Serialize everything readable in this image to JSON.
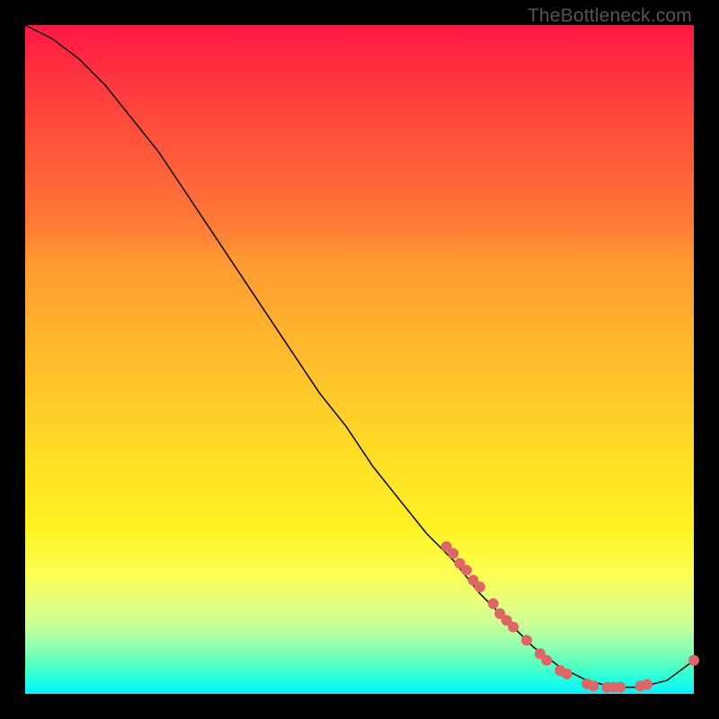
{
  "watermark": "TheBottleneck.com",
  "chart_data": {
    "type": "line",
    "title": "",
    "xlabel": "",
    "ylabel": "",
    "xlim": [
      0,
      100
    ],
    "ylim": [
      0,
      100
    ],
    "series": [
      {
        "name": "curve",
        "x": [
          0,
          4,
          8,
          12,
          16,
          20,
          24,
          28,
          32,
          36,
          40,
          44,
          48,
          52,
          56,
          60,
          64,
          68,
          72,
          76,
          80,
          84,
          88,
          92,
          96,
          100
        ],
        "y": [
          100,
          98,
          95,
          91,
          86,
          81,
          75,
          69,
          63,
          57,
          51,
          45,
          40,
          34,
          29,
          24,
          20,
          15,
          11,
          7,
          4,
          2,
          1,
          1,
          2,
          5
        ]
      }
    ],
    "scatter_points": {
      "name": "markers",
      "color": "#e06666",
      "points": [
        {
          "x": 63,
          "y": 22
        },
        {
          "x": 64,
          "y": 21
        },
        {
          "x": 65,
          "y": 19.5
        },
        {
          "x": 66,
          "y": 18.5
        },
        {
          "x": 67,
          "y": 17
        },
        {
          "x": 68,
          "y": 16
        },
        {
          "x": 70,
          "y": 13.5
        },
        {
          "x": 71,
          "y": 12
        },
        {
          "x": 72,
          "y": 11
        },
        {
          "x": 73,
          "y": 10
        },
        {
          "x": 75,
          "y": 8
        },
        {
          "x": 77,
          "y": 6
        },
        {
          "x": 78,
          "y": 5
        },
        {
          "x": 80,
          "y": 3.5
        },
        {
          "x": 81,
          "y": 3
        },
        {
          "x": 84,
          "y": 1.5
        },
        {
          "x": 85,
          "y": 1.2
        },
        {
          "x": 87,
          "y": 1
        },
        {
          "x": 88,
          "y": 1
        },
        {
          "x": 89,
          "y": 1
        },
        {
          "x": 92,
          "y": 1.2
        },
        {
          "x": 93,
          "y": 1.4
        },
        {
          "x": 100,
          "y": 5
        }
      ]
    }
  }
}
